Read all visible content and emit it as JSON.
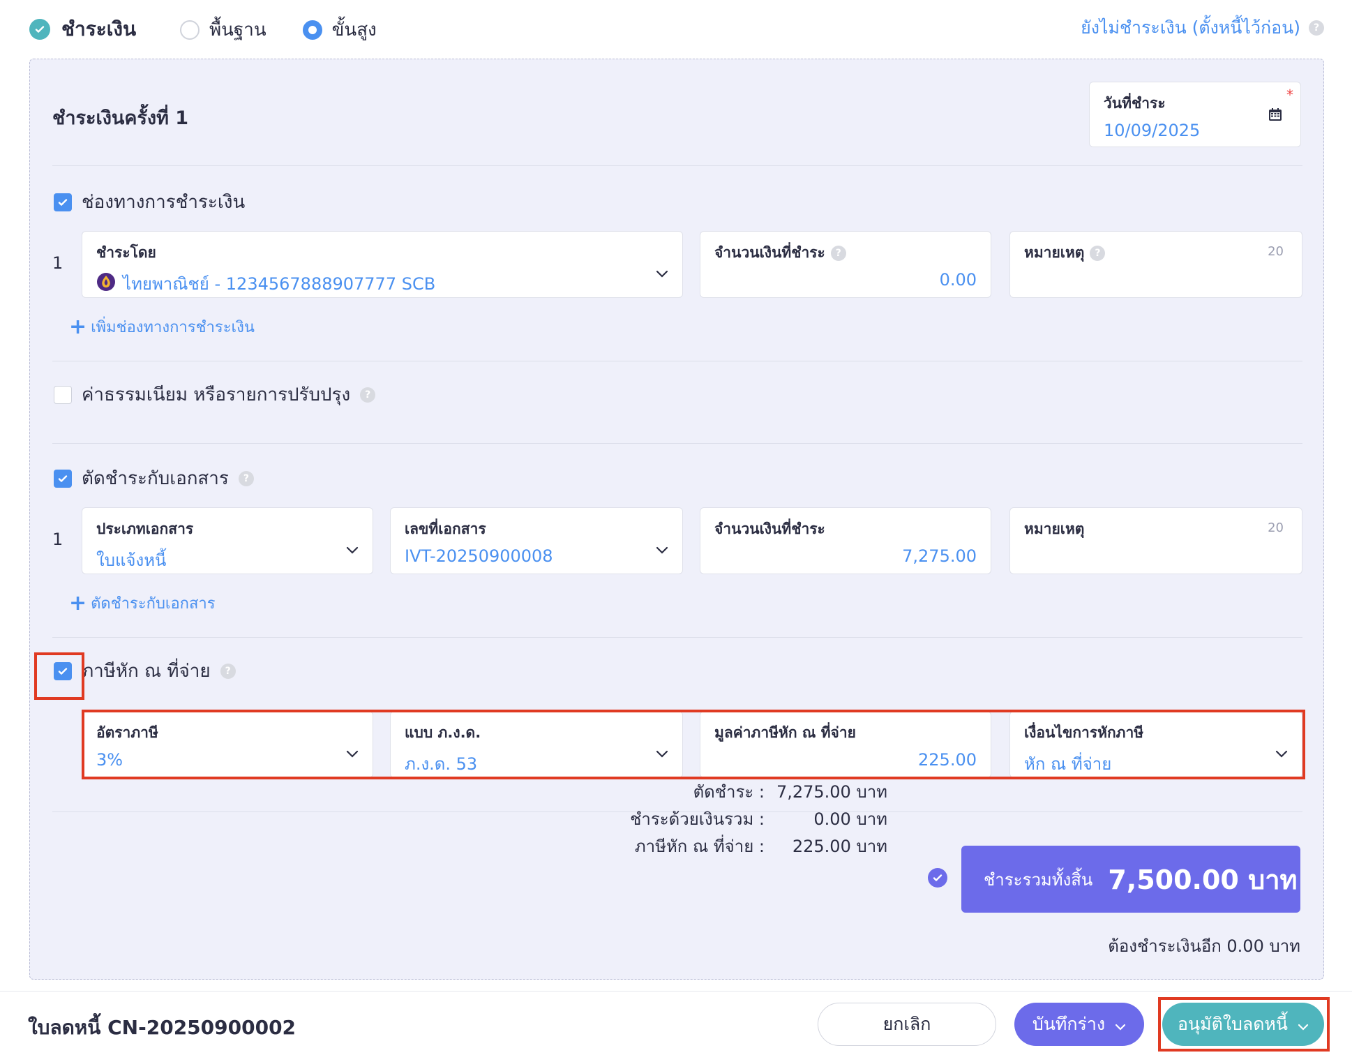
{
  "payment": {
    "title": "ชำระเงิน",
    "mode_basic": "พื้นฐาน",
    "mode_advanced": "ขั้นสูง",
    "selected_mode": "advanced",
    "unpaid_link": "ยังไม่ชำระเงิน (ตั้งหนี้ไว้ก่อน)"
  },
  "installment": {
    "title": "ชำระเงินครั้งที่ 1",
    "date_label": "วันที่ชำระ",
    "date_value": "10/09/2025",
    "required_mark": "*"
  },
  "channels": {
    "checkbox_label": "ช่องทางการชำระเงิน",
    "checked": true,
    "rows": [
      {
        "index": "1",
        "pay_by_label": "ชำระโดย",
        "pay_by_value": "ไทยพาณิชย์ - 1234567888907777 SCB",
        "amount_label": "จำนวนเงินที่ชำระ",
        "amount_value": "0.00",
        "note_label": "หมายเหตุ",
        "note_count": "20"
      }
    ],
    "add_label": "เพิ่มช่องทางการชำระเงิน"
  },
  "fees": {
    "checkbox_label": "ค่าธรรมเนียม หรือรายการปรับปรุง",
    "checked": false
  },
  "settle": {
    "checkbox_label": "ตัดชำระกับเอกสาร",
    "checked": true,
    "rows": [
      {
        "index": "1",
        "doc_type_label": "ประเภทเอกสาร",
        "doc_type_value": "ใบแจ้งหนี้",
        "doc_no_label": "เลขที่เอกสาร",
        "doc_no_value": "IVT-20250900008",
        "amount_label": "จำนวนเงินที่ชำระ",
        "amount_value": "7,275.00",
        "note_label": "หมายเหตุ",
        "note_count": "20"
      }
    ],
    "add_label": "ตัดชำระกับเอกสาร"
  },
  "wht": {
    "checkbox_label": "ภาษีหัก ณ ที่จ่าย",
    "checked": true,
    "rate_label": "อัตราภาษี",
    "rate_value": "3%",
    "form_label": "แบบ ภ.ง.ด.",
    "form_value": "ภ.ง.ด. 53",
    "amount_label": "มูลค่าภาษีหัก ณ ที่จ่าย",
    "amount_value": "225.00",
    "condition_label": "เงื่อนไขการหักภาษี",
    "condition_value": "หัก ณ ที่จ่าย"
  },
  "summary": {
    "settle_label": "ตัดชำระ :",
    "settle_value": "7,275.00 บาท",
    "paid_label": "ชำระด้วยเงินรวม :",
    "paid_value": "0.00 บาท",
    "wht_label": "ภาษีหัก ณ ที่จ่าย :",
    "wht_value": "225.00 บาท",
    "total_label": "ชำระรวมทั้งสิ้น",
    "total_value": "7,500.00 บาท",
    "remaining": "ต้องชำระเงินอีก 0.00 บาท"
  },
  "footer": {
    "doc_title": "ใบลดหนี้ CN-20250900002",
    "cancel_label": "ยกเลิก",
    "draft_label": "บันทึกร่าง",
    "approve_label": "อนุมัติใบลดหนี้"
  },
  "colors": {
    "accent_blue": "#4a90f0",
    "teal": "#4fb5bd",
    "purple": "#6c6bea",
    "highlight_red": "#e03a22",
    "panel_bg": "#eff0fa"
  }
}
